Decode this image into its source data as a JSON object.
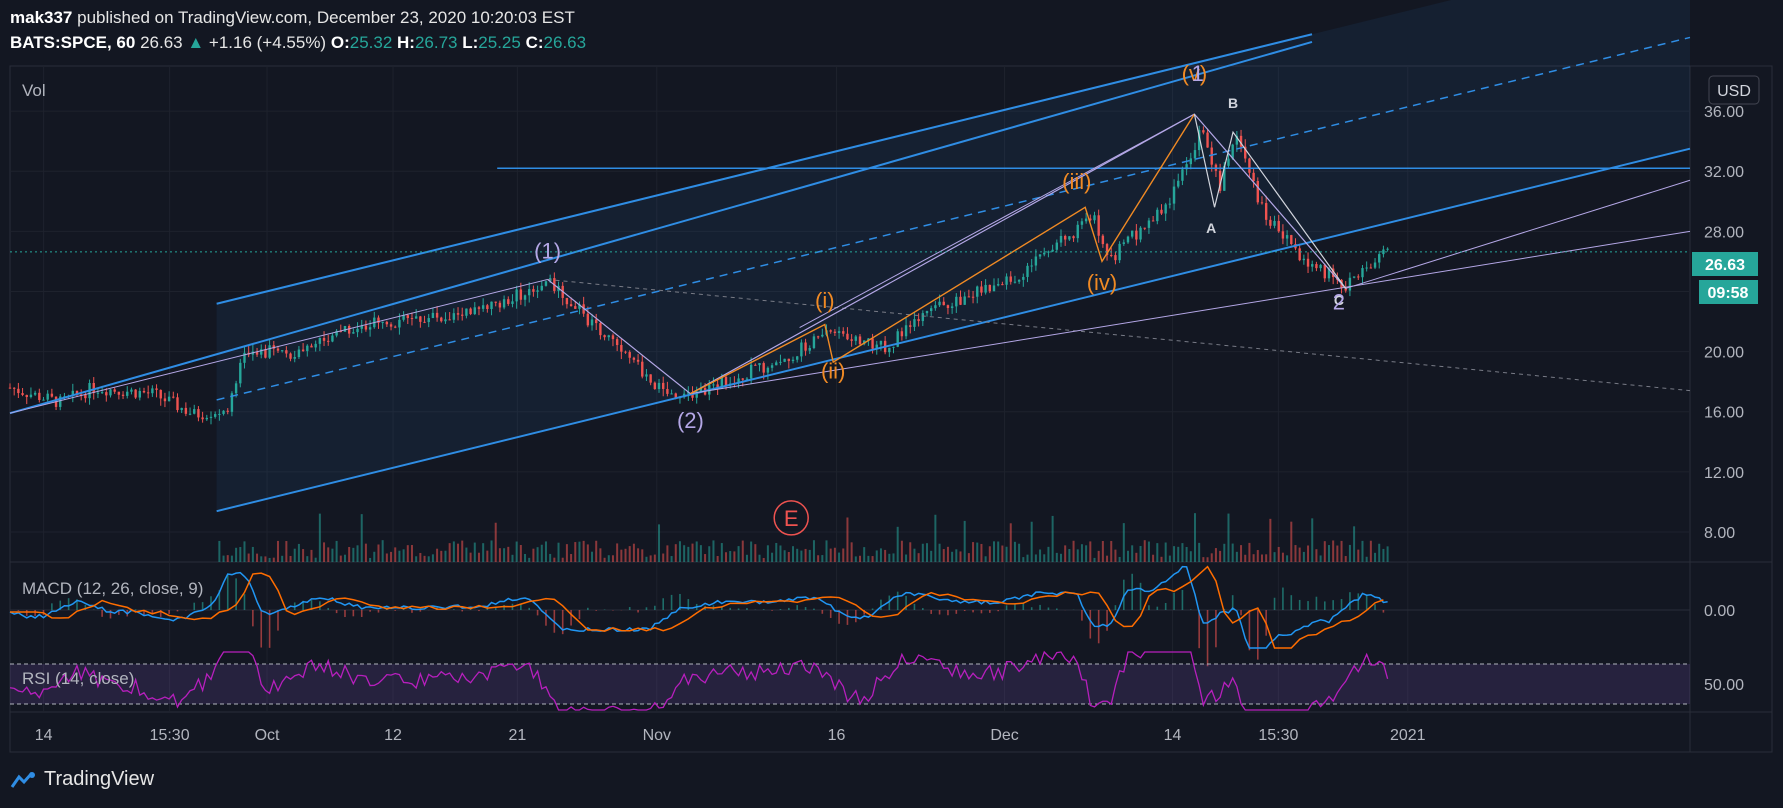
{
  "header": {
    "author": "mak337",
    "published_text": "published on TradingView.com, December 23, 2020 10:20:03 EST",
    "symbol": "BATS:SPCE, 60",
    "price": "26.63",
    "change": "+1.16 (+4.55%)",
    "open_label": "O:",
    "open": "25.32",
    "high_label": "H:",
    "high": "26.73",
    "low_label": "L:",
    "low": "25.25",
    "close_label": "C:",
    "close": "26.63"
  },
  "currency_button": "USD",
  "price_tag": "26.63",
  "timer_tag": "09:58",
  "footer_brand": "TradingView",
  "colors": {
    "background": "#131722",
    "channel": "#2f8de4",
    "wave_orange": "#f08a24",
    "wave_purple": "#b4a7e6",
    "rsi_line": "#b71fbd",
    "macd_line": "#2196f3",
    "signal_line": "#ff6d00",
    "up": "#26a69a",
    "down": "#ef5350"
  },
  "chart_data": {
    "type": "candlestick",
    "ylim": [
      6,
      39
    ],
    "y_ticks": [
      "36.00",
      "32.00",
      "28.00",
      "24.00",
      "20.00",
      "16.00",
      "12.00",
      "8.00"
    ],
    "y_tick_values": [
      36,
      32,
      28,
      24,
      20,
      16,
      12,
      8
    ],
    "x_ticks": [
      "14",
      "15:30",
      "Oct",
      "12",
      "21",
      "Nov",
      "16",
      "Dec",
      "14",
      "15:30",
      "2021"
    ],
    "price_path": [
      [
        0,
        17.6
      ],
      [
        0.03,
        16.6
      ],
      [
        0.05,
        17.6
      ],
      [
        0.085,
        17.2
      ],
      [
        0.11,
        15.8
      ],
      [
        0.13,
        16.2
      ],
      [
        0.14,
        20.2
      ],
      [
        0.17,
        19.8
      ],
      [
        0.2,
        21.6
      ],
      [
        0.26,
        22.4
      ],
      [
        0.29,
        23.0
      ],
      [
        0.32,
        24.8
      ],
      [
        0.35,
        21.5
      ],
      [
        0.39,
        17.2
      ],
      [
        0.41,
        17.4
      ],
      [
        0.46,
        19.5
      ],
      [
        0.49,
        21.5
      ],
      [
        0.52,
        20.2
      ],
      [
        0.55,
        22.8
      ],
      [
        0.6,
        25.0
      ],
      [
        0.645,
        29.0
      ],
      [
        0.655,
        26.2
      ],
      [
        0.69,
        30.0
      ],
      [
        0.71,
        35.0
      ],
      [
        0.72,
        31.0
      ],
      [
        0.73,
        34.5
      ],
      [
        0.745,
        29.5
      ],
      [
        0.77,
        26.0
      ],
      [
        0.795,
        24.5
      ],
      [
        0.82,
        26.6
      ]
    ],
    "wave_labels": [
      {
        "text": "(1)",
        "x": 0.32,
        "y": 26.2,
        "color": "purple"
      },
      {
        "text": "(2)",
        "x": 0.405,
        "y": 14.9,
        "color": "purple"
      },
      {
        "text": "(i)",
        "x": 0.485,
        "y": 22.9,
        "color": "orange"
      },
      {
        "text": "(ii)",
        "x": 0.49,
        "y": 18.2,
        "color": "orange"
      },
      {
        "text": "(iii)",
        "x": 0.635,
        "y": 30.8,
        "color": "orange"
      },
      {
        "text": "(iv)",
        "x": 0.65,
        "y": 24.1,
        "color": "orange"
      },
      {
        "text": "(v)",
        "x": 0.705,
        "y": 38.0,
        "color": "orange"
      },
      {
        "text": "1",
        "x": 0.707,
        "y": 38.0,
        "color": "purple"
      },
      {
        "text": "A",
        "x": 0.715,
        "y": 27.9,
        "color": "white"
      },
      {
        "text": "B",
        "x": 0.728,
        "y": 36.2,
        "color": "white"
      },
      {
        "text": "C",
        "x": 0.791,
        "y": 23.1,
        "color": "white"
      },
      {
        "text": "2",
        "x": 0.791,
        "y": 22.8,
        "color": "purple"
      },
      {
        "text": "E",
        "x": 0.465,
        "y": 8.4,
        "color": "red"
      }
    ],
    "macd": {
      "label": "MACD (12, 26, close, 9)",
      "y_tick": "0.00"
    },
    "rsi": {
      "label": "RSI (14, close)",
      "y_tick": "50.00"
    },
    "volume_label": "Vol"
  }
}
